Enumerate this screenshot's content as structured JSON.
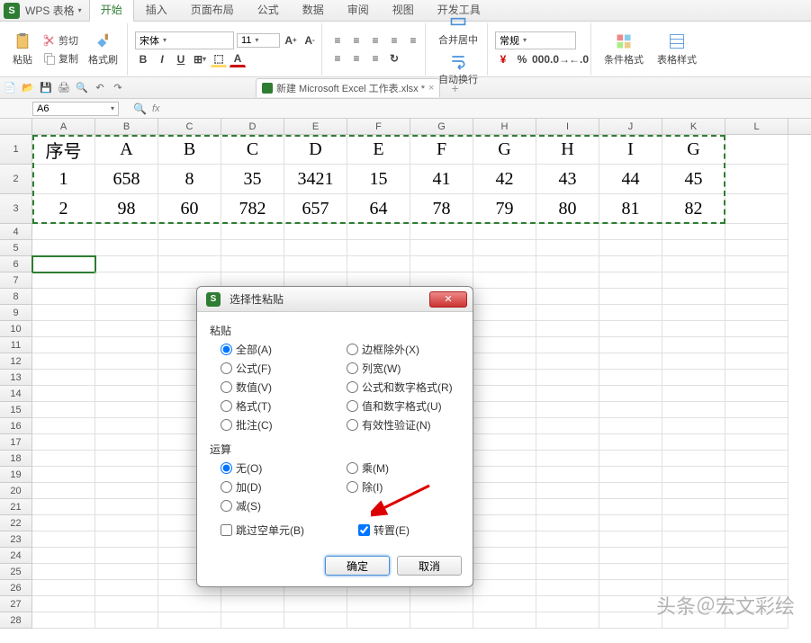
{
  "app": {
    "name": "WPS 表格",
    "logo_letter": "S"
  },
  "menu_tabs": [
    "开始",
    "插入",
    "页面布局",
    "公式",
    "数据",
    "审阅",
    "视图",
    "开发工具"
  ],
  "active_tab_index": 0,
  "ribbon": {
    "paste": "粘贴",
    "cut": "剪切",
    "copy": "复制",
    "format_painter": "格式刷",
    "font_name": "宋体",
    "font_size": "11",
    "merge_center": "合并居中",
    "wrap_text": "自动换行",
    "number_format": "常规",
    "cond_format": "条件格式",
    "table_style": "表格样式"
  },
  "document": {
    "tab_name": "新建 Microsoft Excel 工作表.xlsx *"
  },
  "namebox": "A6",
  "fx": "fx",
  "columns": [
    "A",
    "B",
    "C",
    "D",
    "E",
    "F",
    "G",
    "H",
    "I",
    "J",
    "K",
    "L"
  ],
  "data_rows": [
    [
      "序号",
      "A",
      "B",
      "C",
      "D",
      "E",
      "F",
      "G",
      "H",
      "I",
      "G"
    ],
    [
      "1",
      "658",
      "8",
      "35",
      "3421",
      "15",
      "41",
      "42",
      "43",
      "44",
      "45"
    ],
    [
      "2",
      "98",
      "60",
      "782",
      "657",
      "64",
      "78",
      "79",
      "80",
      "81",
      "82"
    ]
  ],
  "dialog": {
    "title": "选择性粘贴",
    "section_paste": "粘贴",
    "paste_options_left": [
      "全部(A)",
      "公式(F)",
      "数值(V)",
      "格式(T)",
      "批注(C)"
    ],
    "paste_options_right": [
      "边框除外(X)",
      "列宽(W)",
      "公式和数字格式(R)",
      "值和数字格式(U)",
      "有效性验证(N)"
    ],
    "section_op": "运算",
    "op_left": [
      "无(O)",
      "加(D)",
      "减(S)"
    ],
    "op_right": [
      "乘(M)",
      "除(I)"
    ],
    "skip_blanks": "跳过空单元(B)",
    "transpose": "转置(E)",
    "ok": "确定",
    "cancel": "取消"
  },
  "watermark": "头条＠宏文彩绘",
  "selected_paste": 0,
  "selected_op": 0,
  "transpose_checked": true
}
